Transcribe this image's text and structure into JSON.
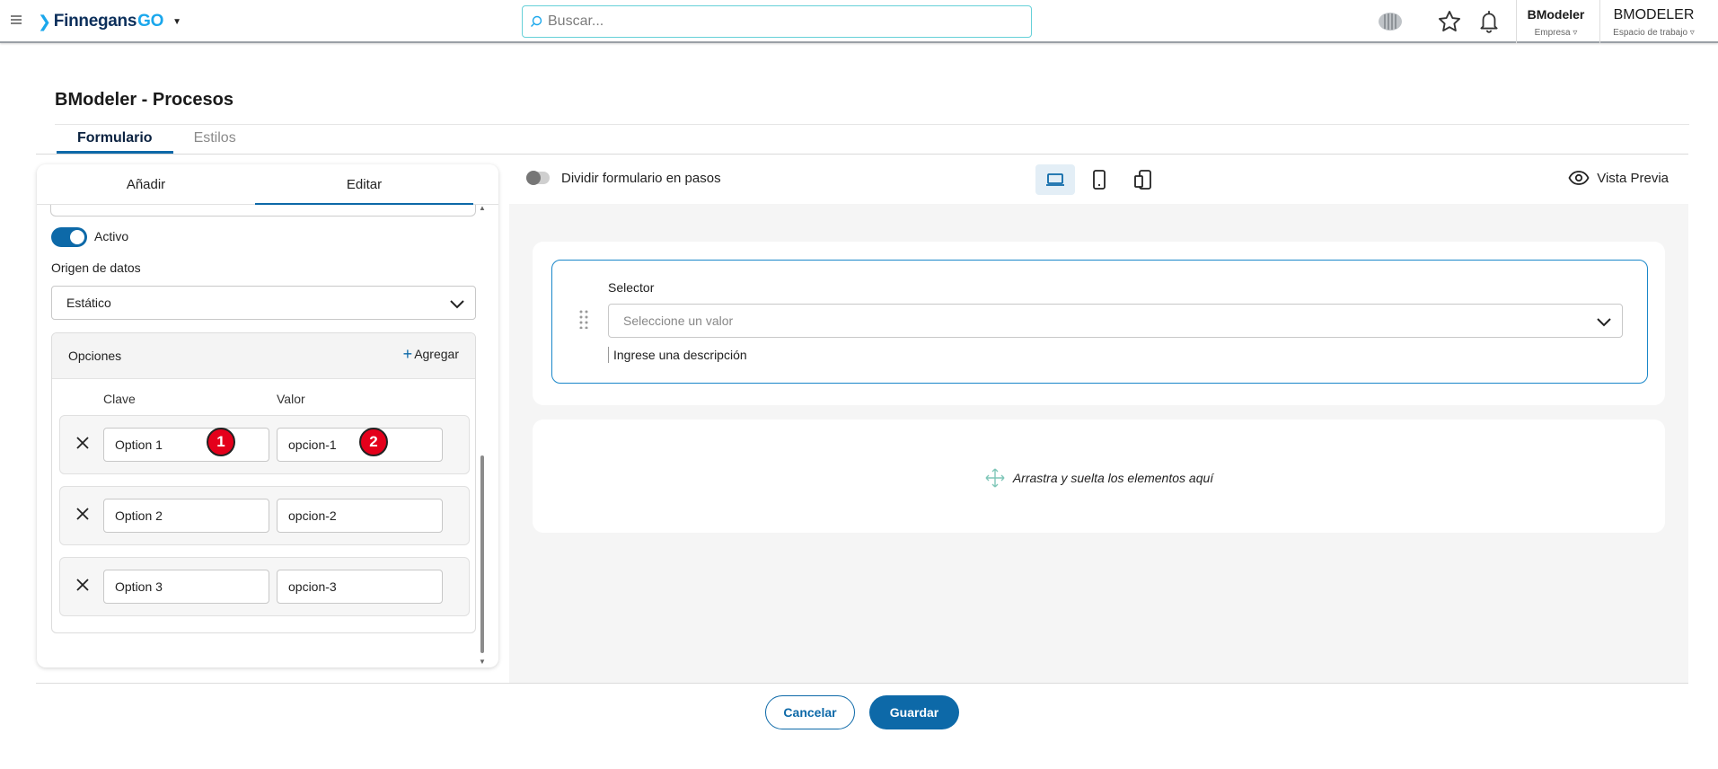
{
  "app": {
    "logo_text": "Finnegans",
    "logo_suffix": "GO"
  },
  "search": {
    "placeholder": "Buscar..."
  },
  "header": {
    "company_name": "BModeler",
    "company_label": "Empresa ▿",
    "workspace_name": "BMODELER",
    "workspace_label": "Espacio de trabajo ▿"
  },
  "page": {
    "title": "BModeler - Procesos",
    "tabs": [
      {
        "label": "Formulario",
        "active": true
      },
      {
        "label": "Estilos",
        "active": false
      }
    ]
  },
  "editor": {
    "tabs": [
      {
        "label": "Añadir",
        "active": false
      },
      {
        "label": "Editar",
        "active": true
      }
    ],
    "active_toggle_label": "Activo",
    "data_source_label": "Origen de datos",
    "data_source_value": "Estático",
    "options": {
      "title": "Opciones",
      "add_label": "Agregar",
      "col_key": "Clave",
      "col_value": "Valor",
      "rows": [
        {
          "key": "Option 1",
          "value": "opcion-1"
        },
        {
          "key": "Option 2",
          "value": "opcion-2"
        },
        {
          "key": "Option 3",
          "value": "opcion-3"
        }
      ]
    },
    "badges": [
      "1",
      "2"
    ]
  },
  "canvas": {
    "split_toggle_label": "Dividir formulario en pasos",
    "preview_label": "Vista Previa",
    "selector": {
      "label": "Selector",
      "placeholder": "Seleccione un valor",
      "description": "Ingrese una descripción"
    },
    "drop_text": "Arrastra y suelta los elementos aquí"
  },
  "footer": {
    "cancel_label": "Cancelar",
    "save_label": "Guardar"
  },
  "colors": {
    "accent": "#0d69a8",
    "badge": "#e4001b",
    "logo_accent": "#1aa7ec"
  }
}
